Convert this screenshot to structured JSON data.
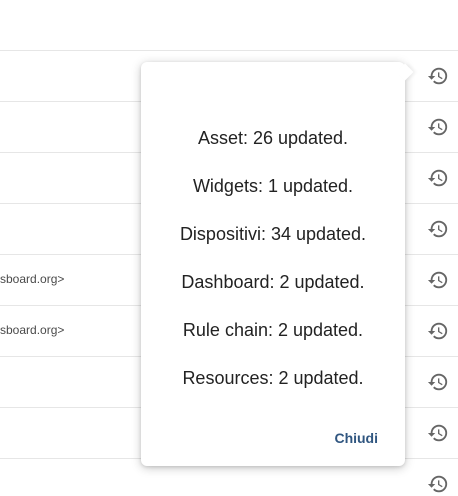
{
  "list": {
    "rows": [
      {
        "text": ""
      },
      {
        "text": ""
      },
      {
        "text": ""
      },
      {
        "text": ""
      },
      {
        "text": "sboard.org>"
      },
      {
        "text": "sboard.org>"
      },
      {
        "text": ""
      },
      {
        "text": ""
      },
      {
        "text": ""
      }
    ],
    "row_icon": "history-icon"
  },
  "popover": {
    "lines": [
      "Asset: 26 updated.",
      "Widgets: 1 updated.",
      "Dispositivi: 34 updated.",
      "Dashboard: 2 updated.",
      "Rule chain: 2 updated.",
      "Resources: 2 updated."
    ],
    "close_label": "Chiudi"
  },
  "colors": {
    "link": "#305680",
    "icon": "#666666",
    "divider": "#e6e6e6"
  }
}
